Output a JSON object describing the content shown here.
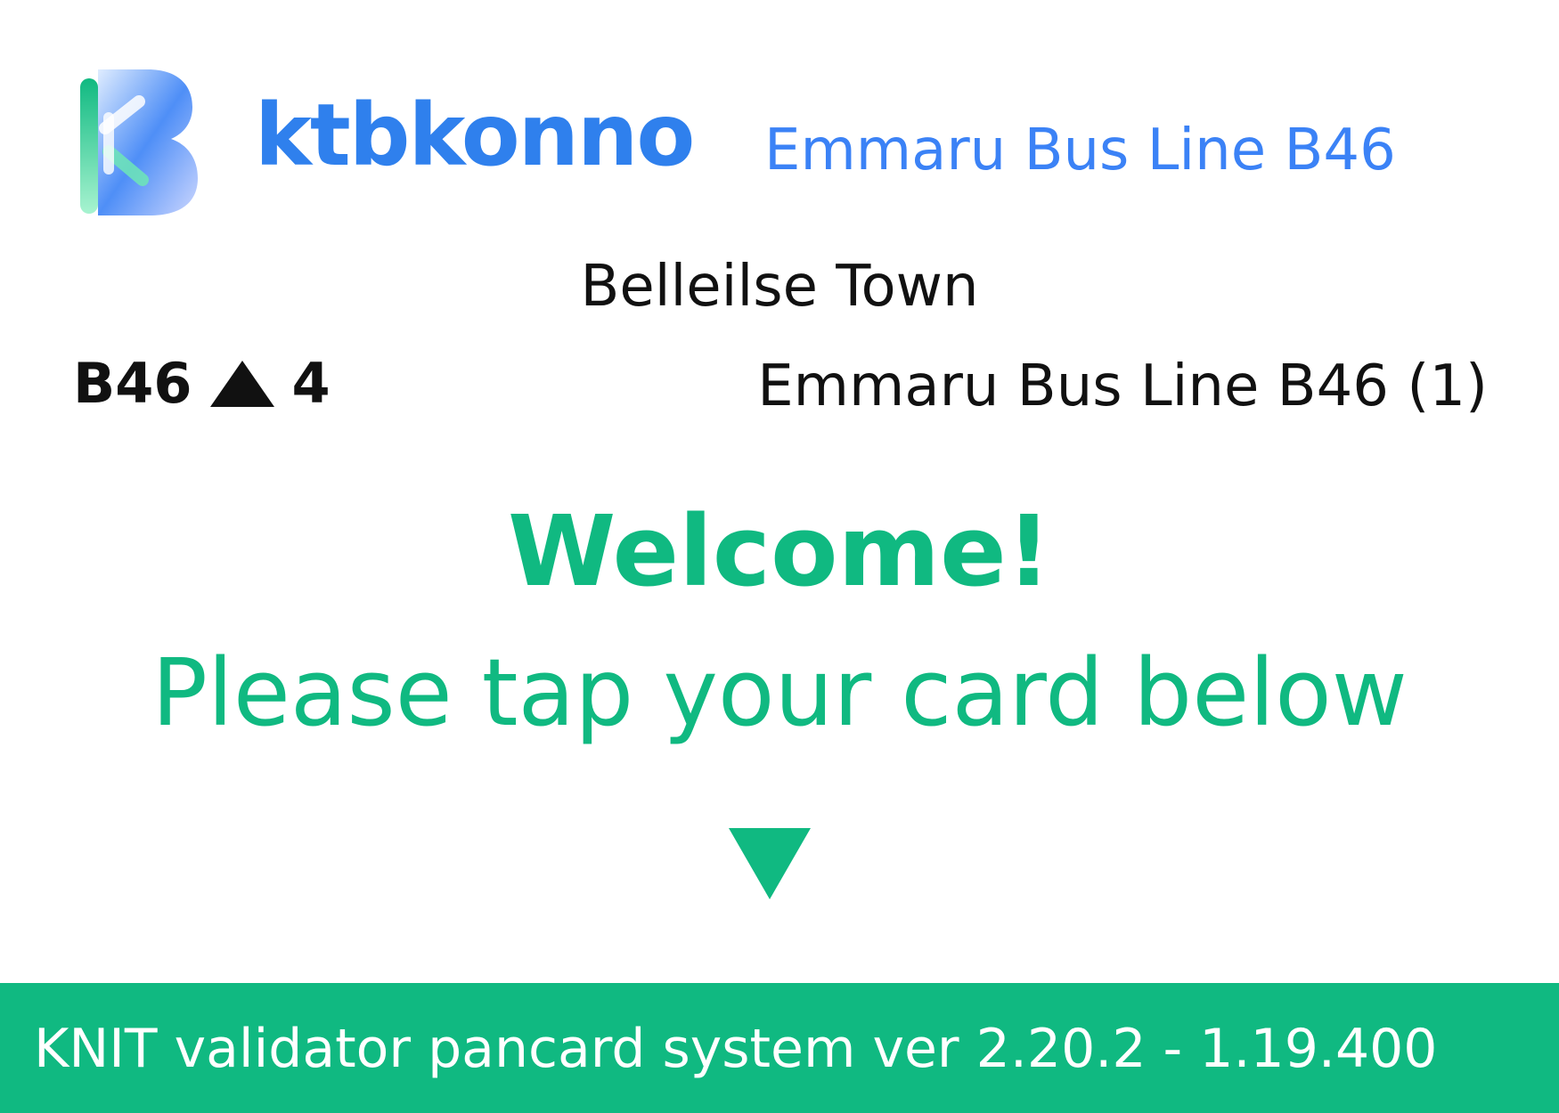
{
  "header": {
    "brand_name": "ktbkonno",
    "line_name": "Emmaru Bus Line B46",
    "logo_icon": "ktbkonno-logo-icon"
  },
  "stop": {
    "current_stop": "Belleilse Town"
  },
  "route": {
    "line_code": "B46",
    "direction_icon": "up-triangle-icon",
    "stop_number": "4",
    "description": "Emmaru Bus Line B46 (1)"
  },
  "message": {
    "welcome": "Welcome!",
    "instruction": "Please tap your card below",
    "arrow_icon": "down-triangle-icon"
  },
  "footer": {
    "system_text": "KNIT validator pancard system ver 2.20.2 - 1.19.400"
  },
  "colors": {
    "brand_blue": "#2f80ed",
    "accent_green": "#10b981",
    "text_dark": "#111111",
    "background": "#ffffff"
  }
}
